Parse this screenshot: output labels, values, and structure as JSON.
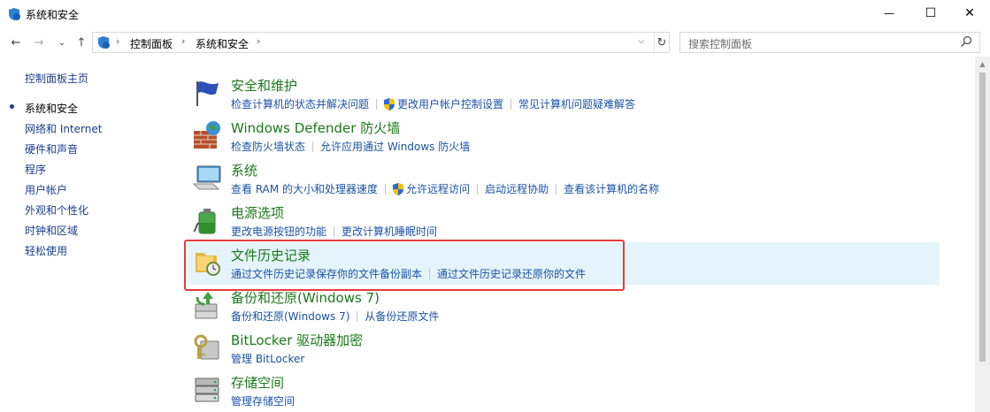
{
  "window": {
    "title": "系统和安全",
    "minimize_glyph": "—",
    "maximize_glyph": "☐",
    "close_glyph": "✕"
  },
  "nav": {
    "back_glyph": "←",
    "forward_glyph": "→",
    "recent_glyph": "⌄",
    "up_glyph": "↑"
  },
  "address": {
    "crumbs": [
      "控制面板",
      "系统和安全"
    ],
    "separator": "›",
    "dropdown_glyph": "⌵",
    "refresh_glyph": "↻"
  },
  "search": {
    "placeholder": "搜索控制面板"
  },
  "sidebar": {
    "items": [
      {
        "label": "控制面板主页",
        "current": false
      },
      {
        "label": "系统和安全",
        "current": true
      },
      {
        "label": "网络和 Internet",
        "current": false
      },
      {
        "label": "硬件和声音",
        "current": false
      },
      {
        "label": "程序",
        "current": false
      },
      {
        "label": "用户帐户",
        "current": false
      },
      {
        "label": "外观和个性化",
        "current": false
      },
      {
        "label": "时钟和区域",
        "current": false
      },
      {
        "label": "轻松使用",
        "current": false
      }
    ]
  },
  "categories": [
    {
      "title": "安全和维护",
      "icon": "flag-icon",
      "links": [
        {
          "label": "检查计算机的状态并解决问题",
          "shield": false
        },
        {
          "label": "更改用户帐户控制设置",
          "shield": true
        },
        {
          "label": "常见计算机问题疑难解答",
          "shield": false
        }
      ]
    },
    {
      "title": "Windows Defender 防火墙",
      "icon": "firewall-icon",
      "links": [
        {
          "label": "检查防火墙状态",
          "shield": false
        },
        {
          "label": "允许应用通过 Windows 防火墙",
          "shield": false
        }
      ]
    },
    {
      "title": "系统",
      "icon": "system-icon",
      "links": [
        {
          "label": "查看 RAM 的大小和处理器速度",
          "shield": false
        },
        {
          "label": "允许远程访问",
          "shield": true
        },
        {
          "label": "启动远程协助",
          "shield": false
        },
        {
          "label": "查看该计算机的名称",
          "shield": false
        }
      ]
    },
    {
      "title": "电源选项",
      "icon": "power-icon",
      "links": [
        {
          "label": "更改电源按钮的功能",
          "shield": false
        },
        {
          "label": "更改计算机睡眠时间",
          "shield": false
        }
      ]
    },
    {
      "title": "文件历史记录",
      "icon": "file-history-icon",
      "highlighted": true,
      "links": [
        {
          "label": "通过文件历史记录保存你的文件备份副本",
          "shield": false
        },
        {
          "label": "通过文件历史记录还原你的文件",
          "shield": false
        }
      ]
    },
    {
      "title": "备份和还原(Windows 7)",
      "icon": "backup-icon",
      "links": [
        {
          "label": "备份和还原(Windows 7)",
          "shield": false
        },
        {
          "label": "从备份还原文件",
          "shield": false
        }
      ]
    },
    {
      "title": "BitLocker 驱动器加密",
      "icon": "bitlocker-icon",
      "links": [
        {
          "label": "管理 BitLocker",
          "shield": false
        }
      ]
    },
    {
      "title": "存储空间",
      "icon": "storage-icon",
      "links": [
        {
          "label": "管理存储空间",
          "shield": false
        }
      ]
    }
  ],
  "colors": {
    "category_title": "#1a7a1a",
    "link": "#1a53a8",
    "highlight_bg": "#e5f3fb",
    "annotation_box": "#e53c3c"
  }
}
